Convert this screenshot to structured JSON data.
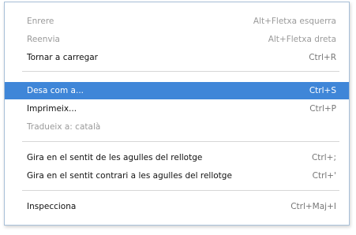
{
  "menu": {
    "items": [
      {
        "label": "Enrere",
        "shortcut": "Alt+Fletxa esquerra"
      },
      {
        "label": "Reenvia",
        "shortcut": "Alt+Fletxa dreta"
      },
      {
        "label": "Tornar a carregar",
        "shortcut": "Ctrl+R"
      },
      {
        "label": "Desa com a...",
        "shortcut": "Ctrl+S"
      },
      {
        "label": "Imprimeix...",
        "shortcut": "Ctrl+P"
      },
      {
        "label": "Tradueix a: català",
        "shortcut": ""
      },
      {
        "label": "Gira en el sentit de les agulles del rellotge",
        "shortcut": "Ctrl+;"
      },
      {
        "label": "Gira en el sentit contrari a les agulles del rellotge",
        "shortcut": "Ctrl+'"
      },
      {
        "label": "Inspecciona",
        "shortcut": "Ctrl+Maj+I"
      }
    ]
  },
  "colors": {
    "highlight": "#3f86d8",
    "disabled_text": "#9a9a9a",
    "border": "#a8c0d8"
  }
}
